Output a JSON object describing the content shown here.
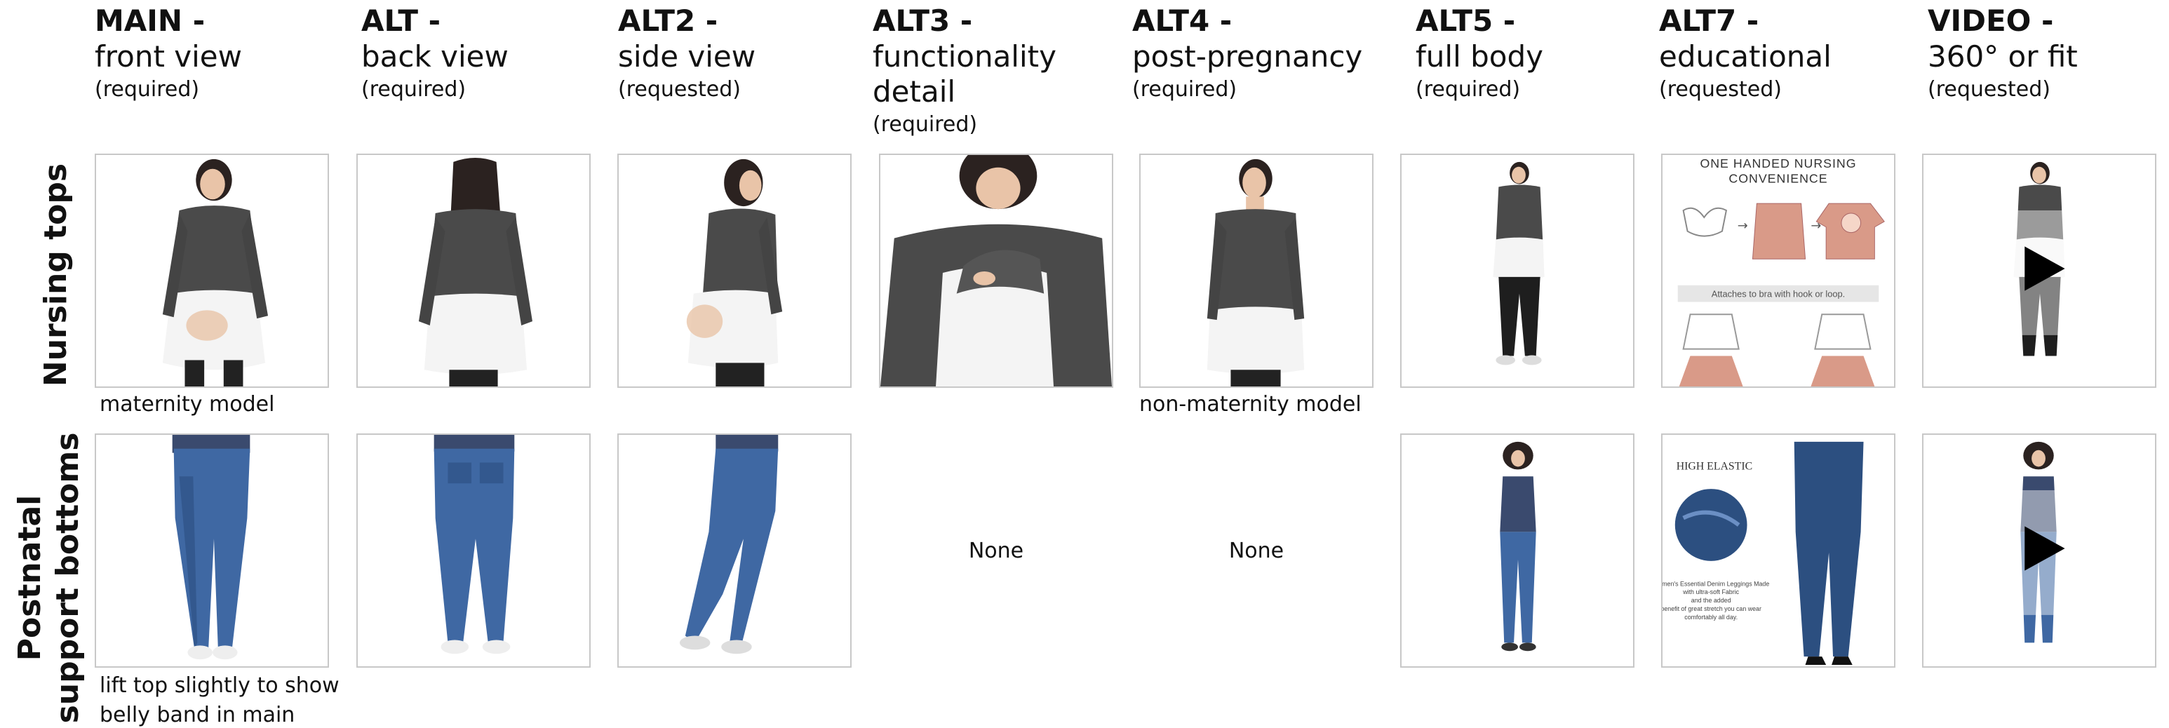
{
  "columns": [
    {
      "key": "main",
      "bold": "MAIN -",
      "desc": [
        "front view"
      ],
      "req": "(required)"
    },
    {
      "key": "alt",
      "bold": "ALT -",
      "desc": [
        "back view"
      ],
      "req": "(required)"
    },
    {
      "key": "alt2",
      "bold": "ALT2 -",
      "desc": [
        "side view"
      ],
      "req": "(requested)"
    },
    {
      "key": "alt3",
      "bold": "ALT3 -",
      "desc": [
        "functionality",
        "detail"
      ],
      "req": "(required)"
    },
    {
      "key": "alt4",
      "bold": "ALT4 -",
      "desc": [
        "post-pregnancy"
      ],
      "req": "(required)"
    },
    {
      "key": "alt5",
      "bold": "ALT5 -",
      "desc": [
        "full body"
      ],
      "req": "(required)"
    },
    {
      "key": "alt7",
      "bold": "ALT7 -",
      "desc": [
        "educational"
      ],
      "req": "(requested)"
    },
    {
      "key": "video",
      "bold": "VIDEO -",
      "desc": [
        "360° or fit"
      ],
      "req": "(requested)"
    }
  ],
  "rows": {
    "nursing": {
      "label": "Nursing tops",
      "notes": {
        "main": "maternity model",
        "alt4": "non-maternity model"
      },
      "educational": {
        "title_line1": "ONE HANDED NURSING",
        "title_line2": "CONVENIENCE",
        "caption": "Attaches to bra with hook or loop."
      }
    },
    "postnatal": {
      "label_line1": "Postnatal",
      "label_line2": "support bottoms",
      "none_alt3": "None",
      "none_alt4": "None",
      "notes": {
        "main_line1": "lift top slightly to show",
        "main_line2": "belly band in main"
      },
      "educational": {
        "heading": "HIGH ELASTIC",
        "body_line1": "Women's Essential Denim Leggings Made",
        "body_line2": "with ultra-soft Fabric",
        "body_line3": "and the added",
        "body_line4": "benefit of great stretch you can wear",
        "body_line5": "comfortably all day."
      }
    }
  },
  "colors": {
    "cell_border": "#c8c8c8",
    "sweater": "#4a4a4a",
    "shirt": "#f4f4f4",
    "denim": "#3f68a3",
    "denim_dark": "#2c4f80",
    "tank": "#3a4a6e",
    "skin": "#e9c4a8",
    "hair": "#2b2220",
    "pink": "#d99a88"
  },
  "icons": {
    "play": "play-icon"
  }
}
